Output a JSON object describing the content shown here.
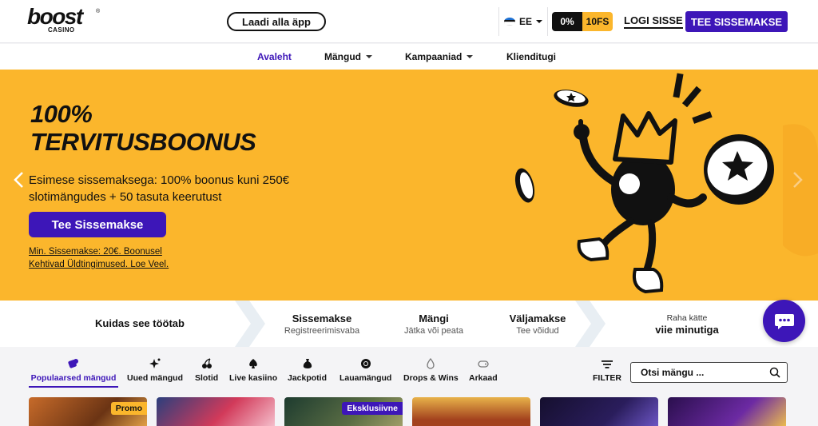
{
  "header": {
    "logo_text": "boost",
    "logo_reg": "®",
    "logo_sub": "CASINO",
    "app_button": "Laadi alla äpp",
    "language": "EE",
    "bonus_percent": "0%",
    "bonus_fs": "10FS",
    "login": "LOGI SISSE",
    "deposit": "TEE SISSEMAKSE"
  },
  "nav": {
    "items": [
      {
        "label": "Avaleht"
      },
      {
        "label": "Mängud"
      },
      {
        "label": "Kampaaniad"
      },
      {
        "label": "Klienditugi"
      }
    ]
  },
  "hero": {
    "title_line1": "100%",
    "title_line2": "TERVITUSBOONUS",
    "subtitle": "Esimese sissemaksega: 100% boonus kuni 250€ slotimängudes + 50 tasuta keerutust",
    "cta": "Tee Sissemakse",
    "terms": "Min. Sissemakse: 20€. Boonusel Kehtivad Üldtingimused. Loe Veel."
  },
  "steps": {
    "intro": "Kuidas see töötab",
    "items": [
      {
        "title": "Sissemakse",
        "sub": "Registreerimisvaba"
      },
      {
        "title": "Mängi",
        "sub": "Jätka või peata"
      },
      {
        "title": "Väljamakse",
        "sub": "Tee võidud"
      }
    ],
    "final_small": "Raha kätte",
    "final_big": "viie minutiga"
  },
  "categories": {
    "items": [
      {
        "label": "Populaarsed mängud",
        "icon": "dice-icon"
      },
      {
        "label": "Uued mängud",
        "icon": "sparkle-icon"
      },
      {
        "label": "Slotid",
        "icon": "cherry-icon"
      },
      {
        "label": "Live kasiino",
        "icon": "spade-icon"
      },
      {
        "label": "Jackpotid",
        "icon": "money-bag-icon"
      },
      {
        "label": "Lauamängud",
        "icon": "chip-icon"
      },
      {
        "label": "Drops & Wins",
        "icon": "drops-icon"
      },
      {
        "label": "Arkaad",
        "icon": "gamepad-icon"
      }
    ],
    "filter": "FILTER",
    "search_placeholder": "Otsi mängu ..."
  },
  "tiles": {
    "badge_promo": "Promo",
    "badge_exclusive": "Eksklusiivne"
  },
  "colors": {
    "brand_purple": "#3d16b8",
    "hero_yellow": "#fbb62c",
    "dark": "#111111"
  }
}
